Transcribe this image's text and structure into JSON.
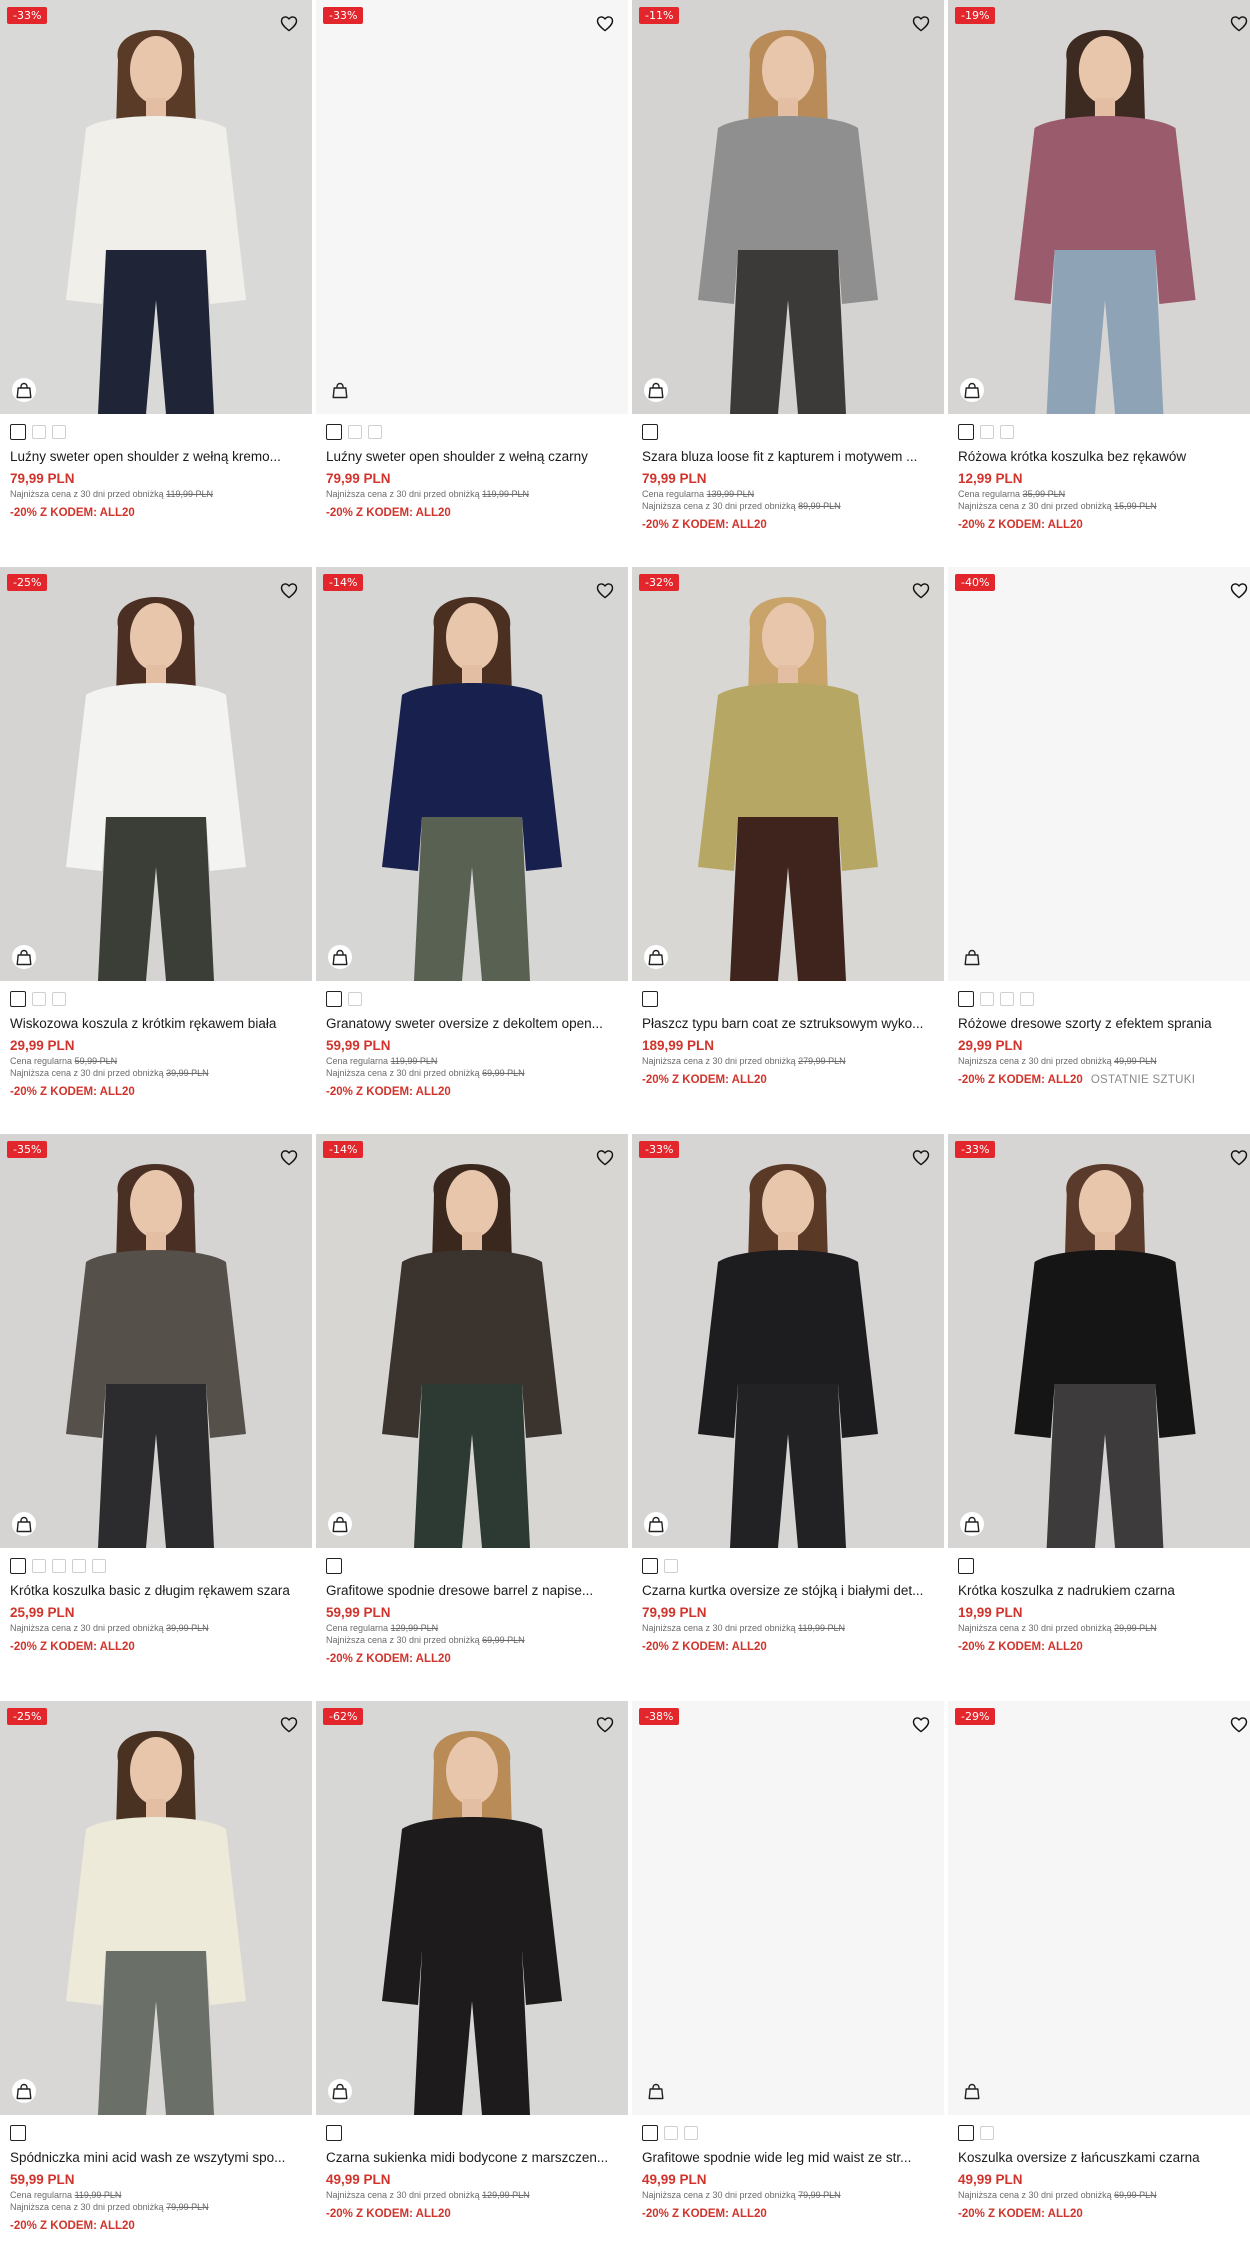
{
  "products": [
    {
      "badge": "-33%",
      "title": "Luźny sweter open shoulder z wełną kremo...",
      "price": "79,99 PLN",
      "regular": "",
      "lowest": "119,99 PLN",
      "promo": "-20% Z KODEM: ALL20",
      "extra": "",
      "swatches": 3,
      "photo": {
        "bg": "#d9d9d7",
        "top": "#f1efea",
        "bottom": "#1f2437",
        "hair": "#5a3b28"
      }
    },
    {
      "badge": "-33%",
      "title": "Luźny sweter open shoulder z wełną czarny",
      "price": "79,99 PLN",
      "regular": "",
      "lowest": "119,99 PLN",
      "promo": "-20% Z KODEM: ALL20",
      "extra": "",
      "swatches": 3,
      "photo": null
    },
    {
      "badge": "-11%",
      "title": "Szara bluza loose fit z kapturem i motywem ...",
      "price": "79,99 PLN",
      "regular": "139,99 PLN",
      "lowest": "89,99 PLN",
      "promo": "-20% Z KODEM: ALL20",
      "extra": "",
      "swatches": 1,
      "photo": {
        "bg": "#d4d3d1",
        "top": "#8f8f8f",
        "bottom": "#3c3a38",
        "hair": "#b98b58"
      }
    },
    {
      "badge": "-19%",
      "title": "Różowa krótka koszulka bez rękawów",
      "price": "12,99 PLN",
      "regular": "35,99 PLN",
      "lowest": "15,99 PLN",
      "promo": "-20% Z KODEM: ALL20",
      "extra": "",
      "swatches": 3,
      "photo": {
        "bg": "#d6d5d3",
        "top": "#9a5b6c",
        "bottom": "#8fa3b6",
        "hair": "#3d2a20"
      }
    },
    {
      "badge": "-25%",
      "title": "Wiskozowa koszula z krótkim rękawem biała",
      "price": "29,99 PLN",
      "regular": "59,99 PLN",
      "lowest": "39,99 PLN",
      "promo": "-20% Z KODEM: ALL20",
      "extra": "",
      "swatches": 3,
      "photo": {
        "bg": "#d5d4d2",
        "top": "#f3f3f1",
        "bottom": "#3a3e36",
        "hair": "#4a2f22"
      }
    },
    {
      "badge": "-14%",
      "title": "Granatowy sweter oversize z dekoltem open...",
      "price": "59,99 PLN",
      "regular": "119,99 PLN",
      "lowest": "69,99 PLN",
      "promo": "-20% Z KODEM: ALL20",
      "extra": "",
      "swatches": 2,
      "photo": {
        "bg": "#d6d6d5",
        "top": "#18214e",
        "bottom": "#596152",
        "hair": "#4b3022"
      }
    },
    {
      "badge": "-32%",
      "title": "Płaszcz typu barn coat ze sztruksowym wyko...",
      "price": "189,99 PLN",
      "regular": "",
      "lowest": "279,99 PLN",
      "promo": "-20% Z KODEM: ALL20",
      "extra": "",
      "swatches": 1,
      "photo": {
        "bg": "#d8d7d4",
        "top": "#b6a765",
        "bottom": "#3e241c",
        "hair": "#c9a46a"
      }
    },
    {
      "badge": "-40%",
      "title": "Różowe dresowe szorty z efektem sprania",
      "price": "29,99 PLN",
      "regular": "",
      "lowest": "49,99 PLN",
      "promo": "-20% Z KODEM: ALL20",
      "extra": "OSTATNIE SZTUKI",
      "swatches": 4,
      "photo": null
    },
    {
      "badge": "-35%",
      "title": "Krótka koszulka basic z długim rękawem szara",
      "price": "25,99 PLN",
      "regular": "",
      "lowest": "39,99 PLN",
      "promo": "-20% Z KODEM: ALL20",
      "extra": "",
      "swatches": 5,
      "photo": {
        "bg": "#d5d4d2",
        "top": "#56504b",
        "bottom": "#2c2c2e",
        "hair": "#4a3024"
      }
    },
    {
      "badge": "-14%",
      "title": "Grafitowe spodnie dresowe barrel z napise...",
      "price": "59,99 PLN",
      "regular": "129,99 PLN",
      "lowest": "69,99 PLN",
      "promo": "-20% Z KODEM: ALL20",
      "extra": "",
      "swatches": 1,
      "photo": {
        "bg": "#d7d6d3",
        "top": "#3b342e",
        "bottom": "#2c3a33",
        "hair": "#3a271d"
      }
    },
    {
      "badge": "-33%",
      "title": "Czarna kurtka oversize ze stójką i białymi det...",
      "price": "79,99 PLN",
      "regular": "",
      "lowest": "119,99 PLN",
      "promo": "-20% Z KODEM: ALL20",
      "extra": "",
      "swatches": 2,
      "photo": {
        "bg": "#d6d5d3",
        "top": "#1d1d20",
        "bottom": "#222224",
        "hair": "#5a3a27"
      }
    },
    {
      "badge": "-33%",
      "title": "Krótka koszulka z nadrukiem czarna",
      "price": "19,99 PLN",
      "regular": "",
      "lowest": "29,99 PLN",
      "promo": "-20% Z KODEM: ALL20",
      "extra": "",
      "swatches": 1,
      "photo": {
        "bg": "#d6d5d3",
        "top": "#151515",
        "bottom": "#3d3b3c",
        "hair": "#5a3a2a"
      }
    },
    {
      "badge": "-25%",
      "title": "Spódniczka mini acid wash ze wszytymi spo...",
      "price": "59,99 PLN",
      "regular": "119,99 PLN",
      "lowest": "79,99 PLN",
      "promo": "-20% Z KODEM: ALL20",
      "extra": "",
      "swatches": 1,
      "photo": {
        "bg": "#d8d7d5",
        "top": "#eeead9",
        "bottom": "#6a6f68",
        "hair": "#4a3222"
      }
    },
    {
      "badge": "-62%",
      "title": "Czarna sukienka midi bodycone z marszczen...",
      "price": "49,99 PLN",
      "regular": "",
      "lowest": "129,99 PLN",
      "promo": "-20% Z KODEM: ALL20",
      "extra": "",
      "swatches": 1,
      "photo": {
        "bg": "#d7d7d5",
        "top": "#1d1b1b",
        "bottom": "#1d1b1b",
        "hair": "#b88b57"
      }
    },
    {
      "badge": "-38%",
      "title": "Grafitowe spodnie wide leg mid waist ze str...",
      "price": "49,99 PLN",
      "regular": "",
      "lowest": "79,99 PLN",
      "promo": "-20% Z KODEM: ALL20",
      "extra": "",
      "swatches": 3,
      "photo": null
    },
    {
      "badge": "-29%",
      "title": "Koszulka oversize z łańcuszkami czarna",
      "price": "49,99 PLN",
      "regular": "",
      "lowest": "69,99 PLN",
      "promo": "-20% Z KODEM: ALL20",
      "extra": "",
      "swatches": 2,
      "photo": null
    }
  ],
  "labels": {
    "regular_prefix": "Cena regularna",
    "lowest_prefix": "Najniższa cena z 30 dni przed obniżką"
  },
  "colors": {
    "accent": "#e3262b",
    "price": "#d0342c"
  }
}
